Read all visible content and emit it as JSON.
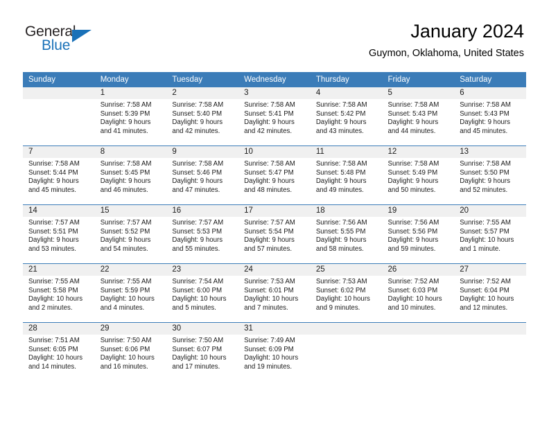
{
  "brand": {
    "name_part1": "General",
    "name_part2": "Blue",
    "accent_color": "#1a71b8"
  },
  "header": {
    "title": "January 2024",
    "location": "Guymon, Oklahoma, United States"
  },
  "theme": {
    "header_row_color": "#3b7cb8",
    "daynum_band_color": "#f0f0f0",
    "week_divider_color": "#3b7cb8",
    "text_color": "#1a1a1a"
  },
  "calendar": {
    "weekday_headers": [
      "Sunday",
      "Monday",
      "Tuesday",
      "Wednesday",
      "Thursday",
      "Friday",
      "Saturday"
    ],
    "weeks": [
      [
        {
          "day": "",
          "lines": []
        },
        {
          "day": "1",
          "lines": [
            "Sunrise: 7:58 AM",
            "Sunset: 5:39 PM",
            "Daylight: 9 hours",
            "and 41 minutes."
          ]
        },
        {
          "day": "2",
          "lines": [
            "Sunrise: 7:58 AM",
            "Sunset: 5:40 PM",
            "Daylight: 9 hours",
            "and 42 minutes."
          ]
        },
        {
          "day": "3",
          "lines": [
            "Sunrise: 7:58 AM",
            "Sunset: 5:41 PM",
            "Daylight: 9 hours",
            "and 42 minutes."
          ]
        },
        {
          "day": "4",
          "lines": [
            "Sunrise: 7:58 AM",
            "Sunset: 5:42 PM",
            "Daylight: 9 hours",
            "and 43 minutes."
          ]
        },
        {
          "day": "5",
          "lines": [
            "Sunrise: 7:58 AM",
            "Sunset: 5:43 PM",
            "Daylight: 9 hours",
            "and 44 minutes."
          ]
        },
        {
          "day": "6",
          "lines": [
            "Sunrise: 7:58 AM",
            "Sunset: 5:43 PM",
            "Daylight: 9 hours",
            "and 45 minutes."
          ]
        }
      ],
      [
        {
          "day": "7",
          "lines": [
            "Sunrise: 7:58 AM",
            "Sunset: 5:44 PM",
            "Daylight: 9 hours",
            "and 45 minutes."
          ]
        },
        {
          "day": "8",
          "lines": [
            "Sunrise: 7:58 AM",
            "Sunset: 5:45 PM",
            "Daylight: 9 hours",
            "and 46 minutes."
          ]
        },
        {
          "day": "9",
          "lines": [
            "Sunrise: 7:58 AM",
            "Sunset: 5:46 PM",
            "Daylight: 9 hours",
            "and 47 minutes."
          ]
        },
        {
          "day": "10",
          "lines": [
            "Sunrise: 7:58 AM",
            "Sunset: 5:47 PM",
            "Daylight: 9 hours",
            "and 48 minutes."
          ]
        },
        {
          "day": "11",
          "lines": [
            "Sunrise: 7:58 AM",
            "Sunset: 5:48 PM",
            "Daylight: 9 hours",
            "and 49 minutes."
          ]
        },
        {
          "day": "12",
          "lines": [
            "Sunrise: 7:58 AM",
            "Sunset: 5:49 PM",
            "Daylight: 9 hours",
            "and 50 minutes."
          ]
        },
        {
          "day": "13",
          "lines": [
            "Sunrise: 7:58 AM",
            "Sunset: 5:50 PM",
            "Daylight: 9 hours",
            "and 52 minutes."
          ]
        }
      ],
      [
        {
          "day": "14",
          "lines": [
            "Sunrise: 7:57 AM",
            "Sunset: 5:51 PM",
            "Daylight: 9 hours",
            "and 53 minutes."
          ]
        },
        {
          "day": "15",
          "lines": [
            "Sunrise: 7:57 AM",
            "Sunset: 5:52 PM",
            "Daylight: 9 hours",
            "and 54 minutes."
          ]
        },
        {
          "day": "16",
          "lines": [
            "Sunrise: 7:57 AM",
            "Sunset: 5:53 PM",
            "Daylight: 9 hours",
            "and 55 minutes."
          ]
        },
        {
          "day": "17",
          "lines": [
            "Sunrise: 7:57 AM",
            "Sunset: 5:54 PM",
            "Daylight: 9 hours",
            "and 57 minutes."
          ]
        },
        {
          "day": "18",
          "lines": [
            "Sunrise: 7:56 AM",
            "Sunset: 5:55 PM",
            "Daylight: 9 hours",
            "and 58 minutes."
          ]
        },
        {
          "day": "19",
          "lines": [
            "Sunrise: 7:56 AM",
            "Sunset: 5:56 PM",
            "Daylight: 9 hours",
            "and 59 minutes."
          ]
        },
        {
          "day": "20",
          "lines": [
            "Sunrise: 7:55 AM",
            "Sunset: 5:57 PM",
            "Daylight: 10 hours",
            "and 1 minute."
          ]
        }
      ],
      [
        {
          "day": "21",
          "lines": [
            "Sunrise: 7:55 AM",
            "Sunset: 5:58 PM",
            "Daylight: 10 hours",
            "and 2 minutes."
          ]
        },
        {
          "day": "22",
          "lines": [
            "Sunrise: 7:55 AM",
            "Sunset: 5:59 PM",
            "Daylight: 10 hours",
            "and 4 minutes."
          ]
        },
        {
          "day": "23",
          "lines": [
            "Sunrise: 7:54 AM",
            "Sunset: 6:00 PM",
            "Daylight: 10 hours",
            "and 5 minutes."
          ]
        },
        {
          "day": "24",
          "lines": [
            "Sunrise: 7:53 AM",
            "Sunset: 6:01 PM",
            "Daylight: 10 hours",
            "and 7 minutes."
          ]
        },
        {
          "day": "25",
          "lines": [
            "Sunrise: 7:53 AM",
            "Sunset: 6:02 PM",
            "Daylight: 10 hours",
            "and 9 minutes."
          ]
        },
        {
          "day": "26",
          "lines": [
            "Sunrise: 7:52 AM",
            "Sunset: 6:03 PM",
            "Daylight: 10 hours",
            "and 10 minutes."
          ]
        },
        {
          "day": "27",
          "lines": [
            "Sunrise: 7:52 AM",
            "Sunset: 6:04 PM",
            "Daylight: 10 hours",
            "and 12 minutes."
          ]
        }
      ],
      [
        {
          "day": "28",
          "lines": [
            "Sunrise: 7:51 AM",
            "Sunset: 6:05 PM",
            "Daylight: 10 hours",
            "and 14 minutes."
          ]
        },
        {
          "day": "29",
          "lines": [
            "Sunrise: 7:50 AM",
            "Sunset: 6:06 PM",
            "Daylight: 10 hours",
            "and 16 minutes."
          ]
        },
        {
          "day": "30",
          "lines": [
            "Sunrise: 7:50 AM",
            "Sunset: 6:07 PM",
            "Daylight: 10 hours",
            "and 17 minutes."
          ]
        },
        {
          "day": "31",
          "lines": [
            "Sunrise: 7:49 AM",
            "Sunset: 6:09 PM",
            "Daylight: 10 hours",
            "and 19 minutes."
          ]
        },
        {
          "day": "",
          "lines": []
        },
        {
          "day": "",
          "lines": []
        },
        {
          "day": "",
          "lines": []
        }
      ]
    ]
  }
}
